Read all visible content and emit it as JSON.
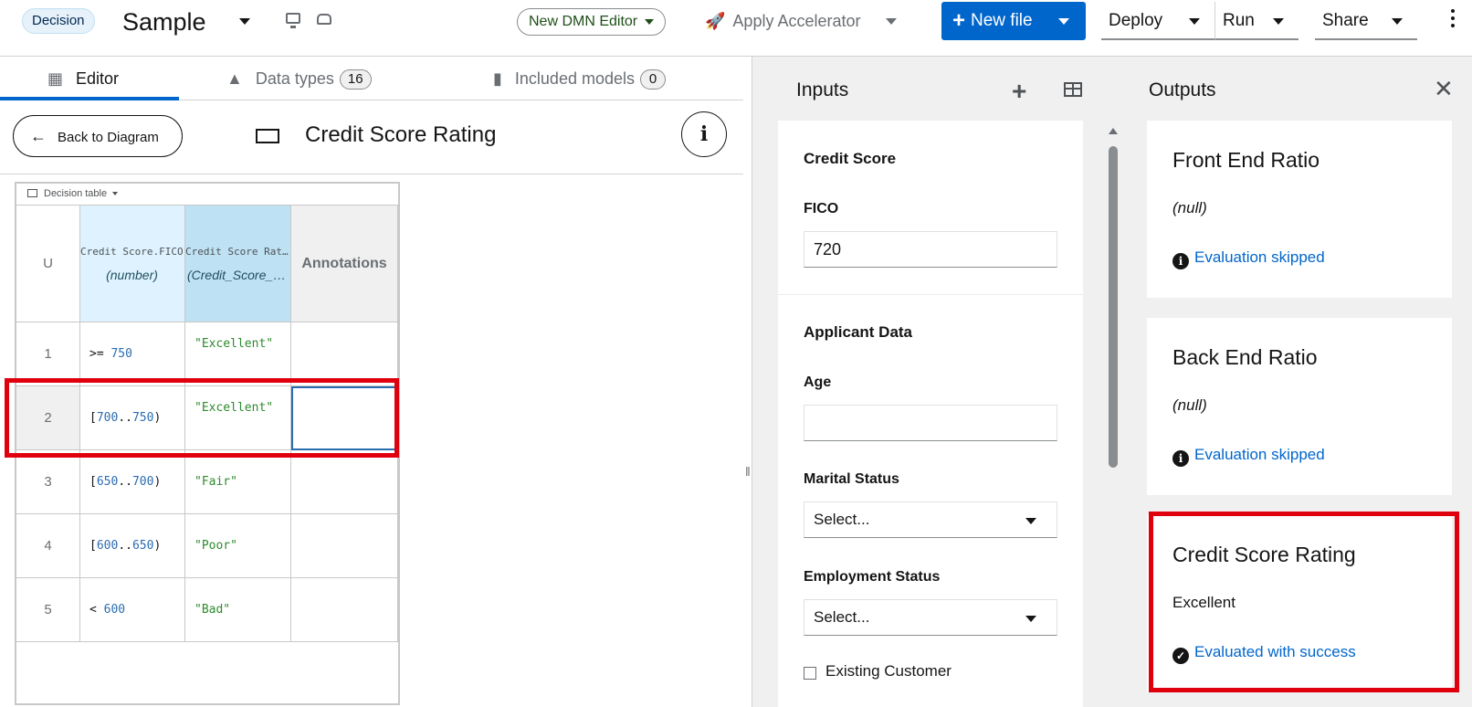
{
  "header": {
    "badge": "Decision",
    "title": "Sample",
    "editor_toggle": "New DMN Editor",
    "accelerator": "Apply Accelerator",
    "new_file": "New file",
    "deploy": "Deploy",
    "run": "Run",
    "share": "Share"
  },
  "tabs": [
    {
      "label": "Editor"
    },
    {
      "label": "Data types",
      "count": "16"
    },
    {
      "label": "Included models",
      "count": "0"
    }
  ],
  "editor": {
    "back_label": "Back to Diagram",
    "decision_title": "Credit Score Rating",
    "info_label": "i"
  },
  "decision_table": {
    "type_label": "Decision table",
    "hit_policy": "U",
    "input_column": {
      "name": "Credit Score.FICO",
      "type": "(number)"
    },
    "output_column": {
      "name": "Credit Score Rating",
      "type": "(Credit_Score_Rating)"
    },
    "annotation_header": "Annotations",
    "rows": [
      {
        "num": "1",
        "op": ">=",
        "a": "750",
        "b": "",
        "close": "",
        "open": "",
        "output": "\"Excellent\"",
        "annotation": ""
      },
      {
        "num": "2",
        "op": "",
        "open": "[",
        "a": "700",
        "b": "750",
        "close": ")",
        "output": "\"Excellent\"",
        "annotation": ""
      },
      {
        "num": "3",
        "op": "",
        "open": "[",
        "a": "650",
        "b": "700",
        "close": ")",
        "output": "\"Fair\"",
        "annotation": ""
      },
      {
        "num": "4",
        "op": "",
        "open": "[",
        "a": "600",
        "b": "650",
        "close": ")",
        "output": "\"Poor\"",
        "annotation": ""
      },
      {
        "num": "5",
        "op": "<",
        "a": "600",
        "b": "",
        "close": "",
        "open": "",
        "output": "\"Bad\"",
        "annotation": ""
      }
    ]
  },
  "inputs": {
    "title": "Inputs",
    "credit_score": {
      "title": "Credit Score",
      "fico_label": "FICO",
      "fico_value": "720"
    },
    "applicant": {
      "title": "Applicant Data",
      "age_label": "Age",
      "age_value": "",
      "marital_label": "Marital Status",
      "marital_value": "Select...",
      "employment_label": "Employment Status",
      "employment_value": "Select...",
      "existing_label": "Existing Customer"
    }
  },
  "outputs": {
    "title": "Outputs",
    "cards": [
      {
        "title": "Front End Ratio",
        "value": "(null)",
        "status": "Evaluation skipped"
      },
      {
        "title": "Back End Ratio",
        "value": "(null)",
        "status": "Evaluation skipped"
      },
      {
        "title": "Credit Score Rating",
        "value": "Excellent",
        "status": "Evaluated with success"
      }
    ]
  },
  "colors": {
    "primary": "#0066cc",
    "highlight": "#e0000d",
    "success_string": "#2e8b2e"
  },
  "icons": [
    "monitor-icon",
    "drive-icon",
    "rocket-icon",
    "plus-icon",
    "table-icon",
    "close-icon",
    "info-icon",
    "check-circle-icon"
  ]
}
